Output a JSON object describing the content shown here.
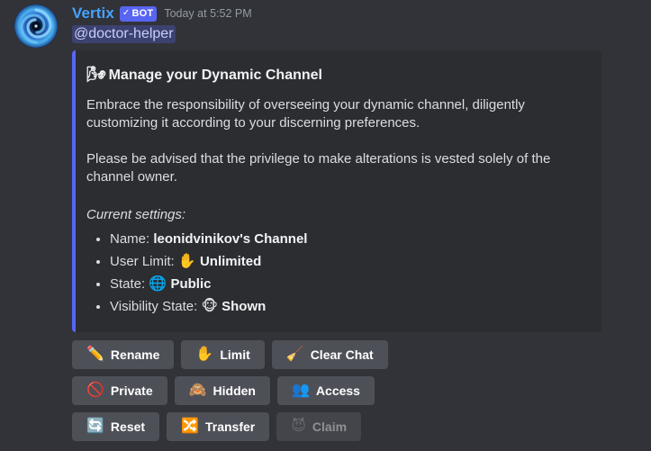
{
  "message": {
    "author": "Vertix",
    "bot_tag": "BOT",
    "bot_check": "✓",
    "timestamp": "Today at 5:52 PM",
    "mention": "@doctor-helper",
    "avatar_icon": "blue-vortex-avatar",
    "author_color": "#46a3ff",
    "bot_tag_color": "#5865f2"
  },
  "embed": {
    "accent_color": "#5865f2",
    "title_emoji": "🌬",
    "title": "Manage your Dynamic Channel",
    "paragraphs": [
      "Embrace the responsibility of overseeing your dynamic channel, diligently customizing it according to your discerning preferences.",
      "Please be advised that the privilege to make alterations is vested solely of the channel owner."
    ],
    "settings_label": "Current settings",
    "settings": [
      {
        "label": "Name",
        "emoji": "",
        "value": "leonidvinikov's Channel"
      },
      {
        "label": "User Limit",
        "emoji": "✋",
        "value": "Unlimited"
      },
      {
        "label": "State",
        "emoji": "🌐",
        "value": "Public"
      },
      {
        "label": "Visibility State",
        "emoji": "🐵",
        "value": "Shown"
      }
    ]
  },
  "buttons": {
    "rows": [
      [
        {
          "emoji": "✏️",
          "label": "Rename",
          "icon": "pencil-icon",
          "disabled": false
        },
        {
          "emoji": "✋",
          "label": "Limit",
          "icon": "raised-hand-icon",
          "disabled": false
        },
        {
          "emoji": "🧹",
          "label": "Clear Chat",
          "icon": "broom-icon",
          "disabled": false
        }
      ],
      [
        {
          "emoji": "🚫",
          "label": "Private",
          "icon": "prohibited-icon",
          "disabled": false
        },
        {
          "emoji": "🙈",
          "label": "Hidden",
          "icon": "see-no-evil-monkey-icon",
          "disabled": false
        },
        {
          "emoji": "👥",
          "label": "Access",
          "icon": "busts-in-silhouette-icon",
          "disabled": false
        }
      ],
      [
        {
          "emoji": "🔄",
          "label": "Reset",
          "icon": "counterclockwise-arrows-icon",
          "disabled": false
        },
        {
          "emoji": "🔀",
          "label": "Transfer",
          "icon": "shuffle-arrows-icon",
          "disabled": false
        },
        {
          "emoji": "😈",
          "label": "Claim",
          "icon": "smiling-imp-icon",
          "disabled": true
        }
      ]
    ]
  }
}
